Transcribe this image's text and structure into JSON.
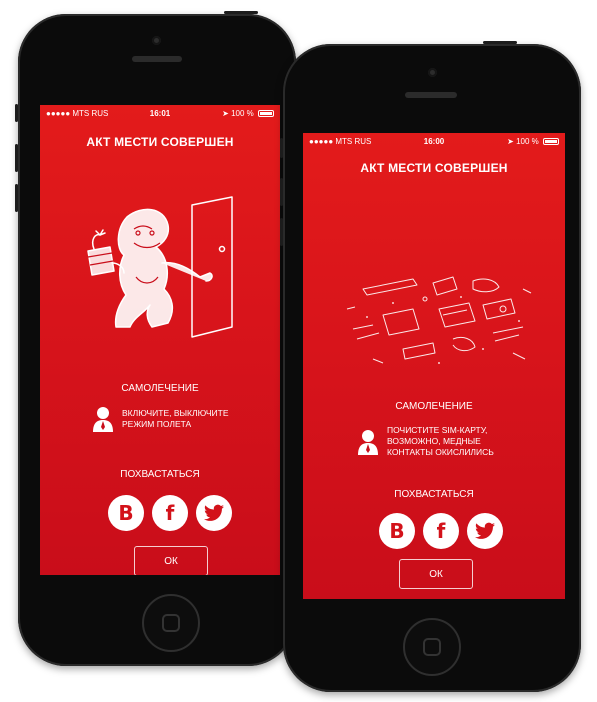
{
  "colors": {
    "accent": "#d3121a",
    "phone_body": "#0b0b0b",
    "text": "#ffffff"
  },
  "left_phone": {
    "status": {
      "carrier": "●●●●● MTS RUS",
      "time": "16:01",
      "battery": "100 %"
    },
    "title": "АКТ МЕСТИ СОВЕРШЕН",
    "illustration": "bulldog-with-dynamite-at-door",
    "section_label": "САМОЛЕЧЕНИЕ",
    "tip_lines": [
      "ВКЛЮЧИТЕ, ВЫКЛЮЧИТЕ",
      "РЕЖИМ ПОЛЕТА"
    ],
    "share_label": "ПОХВАСТАТЬСЯ",
    "social": {
      "vk": "B",
      "facebook": "f",
      "twitter": "twitter-bird-icon"
    },
    "ok_label": "ОК"
  },
  "right_phone": {
    "status": {
      "carrier": "●●●●● MTS RUS",
      "time": "16:00",
      "battery": "100 %"
    },
    "title": "АКТ МЕСТИ СОВЕРШЕН",
    "illustration": "scattered-broken-office-items",
    "section_label": "САМОЛЕЧЕНИЕ",
    "tip_lines": [
      "ПОЧИСТИТЕ SIM-КАРТУ,",
      "ВОЗМОЖНО, МЕДНЫЕ",
      "КОНТАКТЫ ОКИСЛИЛИСЬ"
    ],
    "share_label": "ПОХВАСТАТЬСЯ",
    "social": {
      "vk": "B",
      "facebook": "f",
      "twitter": "twitter-bird-icon"
    },
    "ok_label": "ОК"
  }
}
